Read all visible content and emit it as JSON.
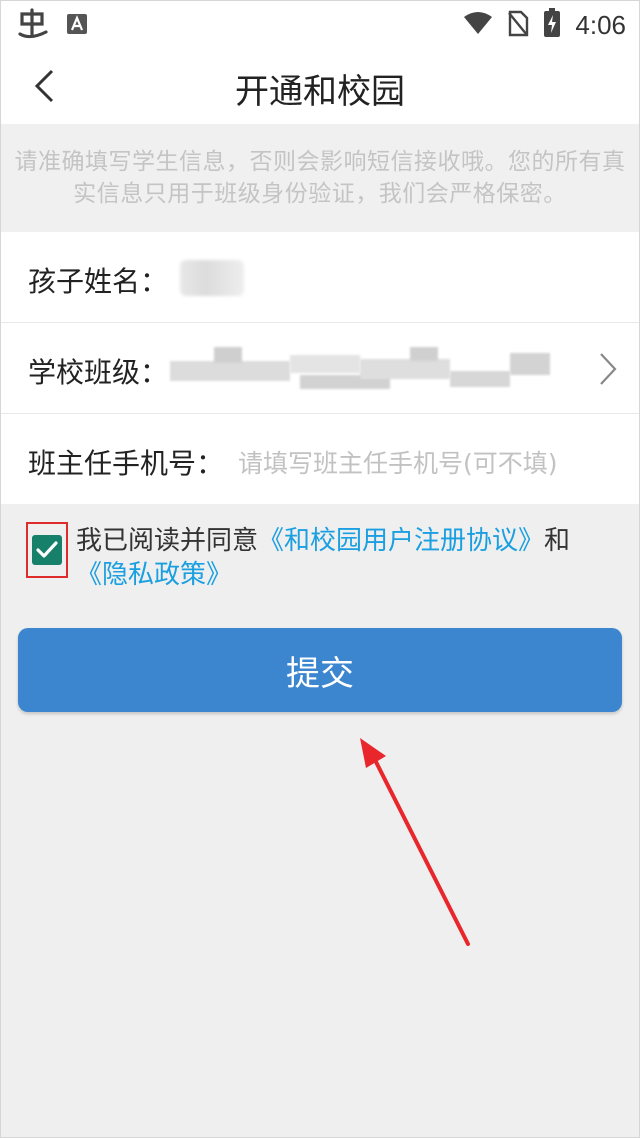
{
  "status_bar": {
    "time": "4:06",
    "icons": [
      "app-logo-icon",
      "a-notification-icon",
      "wifi-icon",
      "no-sim-icon",
      "battery-charging-icon"
    ]
  },
  "header": {
    "title": "开通和校园",
    "back_icon": "chevron-left-icon"
  },
  "notice": {
    "text": "请准确填写学生信息，否则会影响短信接收哦。您的所有真实信息只用于班级身份验证，我们会严格保密。"
  },
  "form": {
    "child_name": {
      "label": "孩子姓名："
    },
    "school_class": {
      "label": "学校班级：",
      "icon": "chevron-right-icon"
    },
    "teacher_phone": {
      "label": "班主任手机号：",
      "placeholder": "请填写班主任手机号(可不填)"
    }
  },
  "agreement": {
    "checked": true,
    "prefix": "我已阅读并同意",
    "link_terms": "《和校园用户注册协议》",
    "conjunction": "和",
    "link_privacy": "《隐私政策》"
  },
  "submit": {
    "label": "提交"
  },
  "colors": {
    "accent_blue": "#3b86cf",
    "link_blue": "#1a9fe0",
    "checkbox_green": "#17806b",
    "highlight_red": "#e02b2b"
  }
}
